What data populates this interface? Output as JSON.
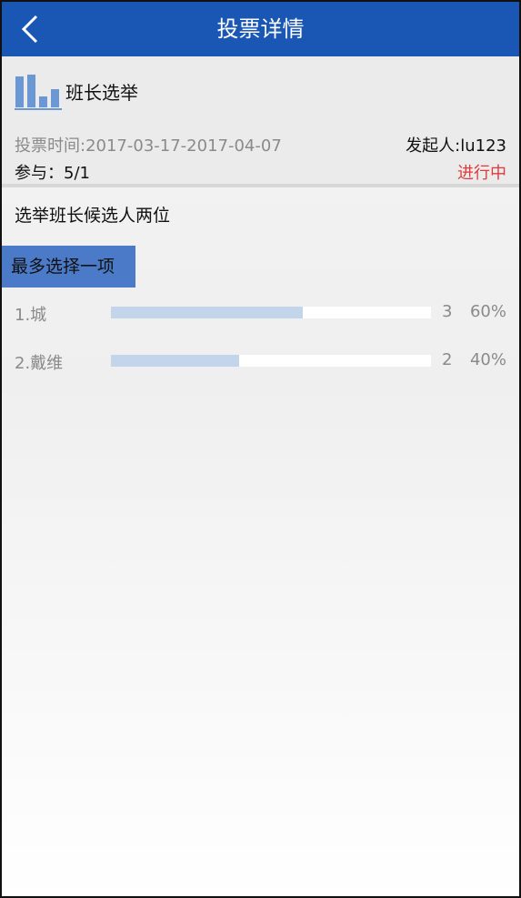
{
  "header": {
    "title": "投票详情",
    "back_icon": "chevron-left-icon"
  },
  "poll": {
    "icon": "bar-chart-icon",
    "title": "班长选举",
    "time": "投票时间:2017-03-17-2017-04-07",
    "initiator": "发起人:lu123",
    "participation": "参与：5/1",
    "status": "进行中",
    "status_color": "#e03a3a",
    "question": "选举班长候选人两位",
    "choice_rule": "最多选择一项",
    "options": [
      {
        "label": "1.城",
        "count": "3",
        "percent": "60%",
        "fraction": 0.6
      },
      {
        "label": "2.戴维",
        "count": "2",
        "percent": "40%",
        "fraction": 0.4
      }
    ]
  },
  "colors": {
    "header_bg": "#1a57b5",
    "badge_bg": "#4a7ac8",
    "bar_fill": "#c3d5ea"
  }
}
